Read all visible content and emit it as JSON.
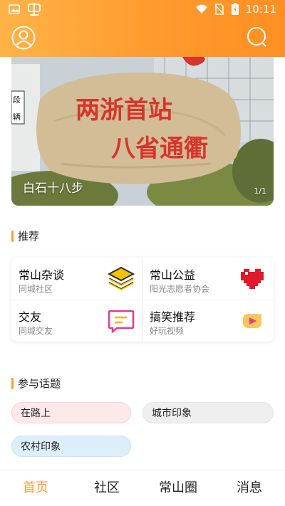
{
  "status_bar": {
    "time": "10:11"
  },
  "colors": {
    "accent": "#ff9a2e",
    "chip_pink": "#fde8ea",
    "chip_gray": "#efefef",
    "chip_blue": "#ddeefb"
  },
  "banner": {
    "caption": "白石十八步",
    "index": "1/1",
    "stone_text_line1": "两浙首站",
    "stone_text_line2": "八省通衢",
    "sign_chars": "段\n辆"
  },
  "recommend": {
    "title": "推荐",
    "items": [
      {
        "title": "常山杂谈",
        "subtitle": "同城社区",
        "icon": "stack-icon"
      },
      {
        "title": "常山公益",
        "subtitle": "阳光志愿者协会",
        "icon": "heart-icon"
      },
      {
        "title": "交友",
        "subtitle": "同城交友",
        "icon": "chat-icon"
      },
      {
        "title": "搞笑推荐",
        "subtitle": "好玩视频",
        "icon": "video-icon"
      }
    ]
  },
  "topics": {
    "title": "参与话题",
    "chips": [
      "在路上",
      "城市印象",
      "农村印象"
    ]
  },
  "nav": {
    "items": [
      "首页",
      "社区",
      "常山圈",
      "消息"
    ],
    "active": 0
  }
}
